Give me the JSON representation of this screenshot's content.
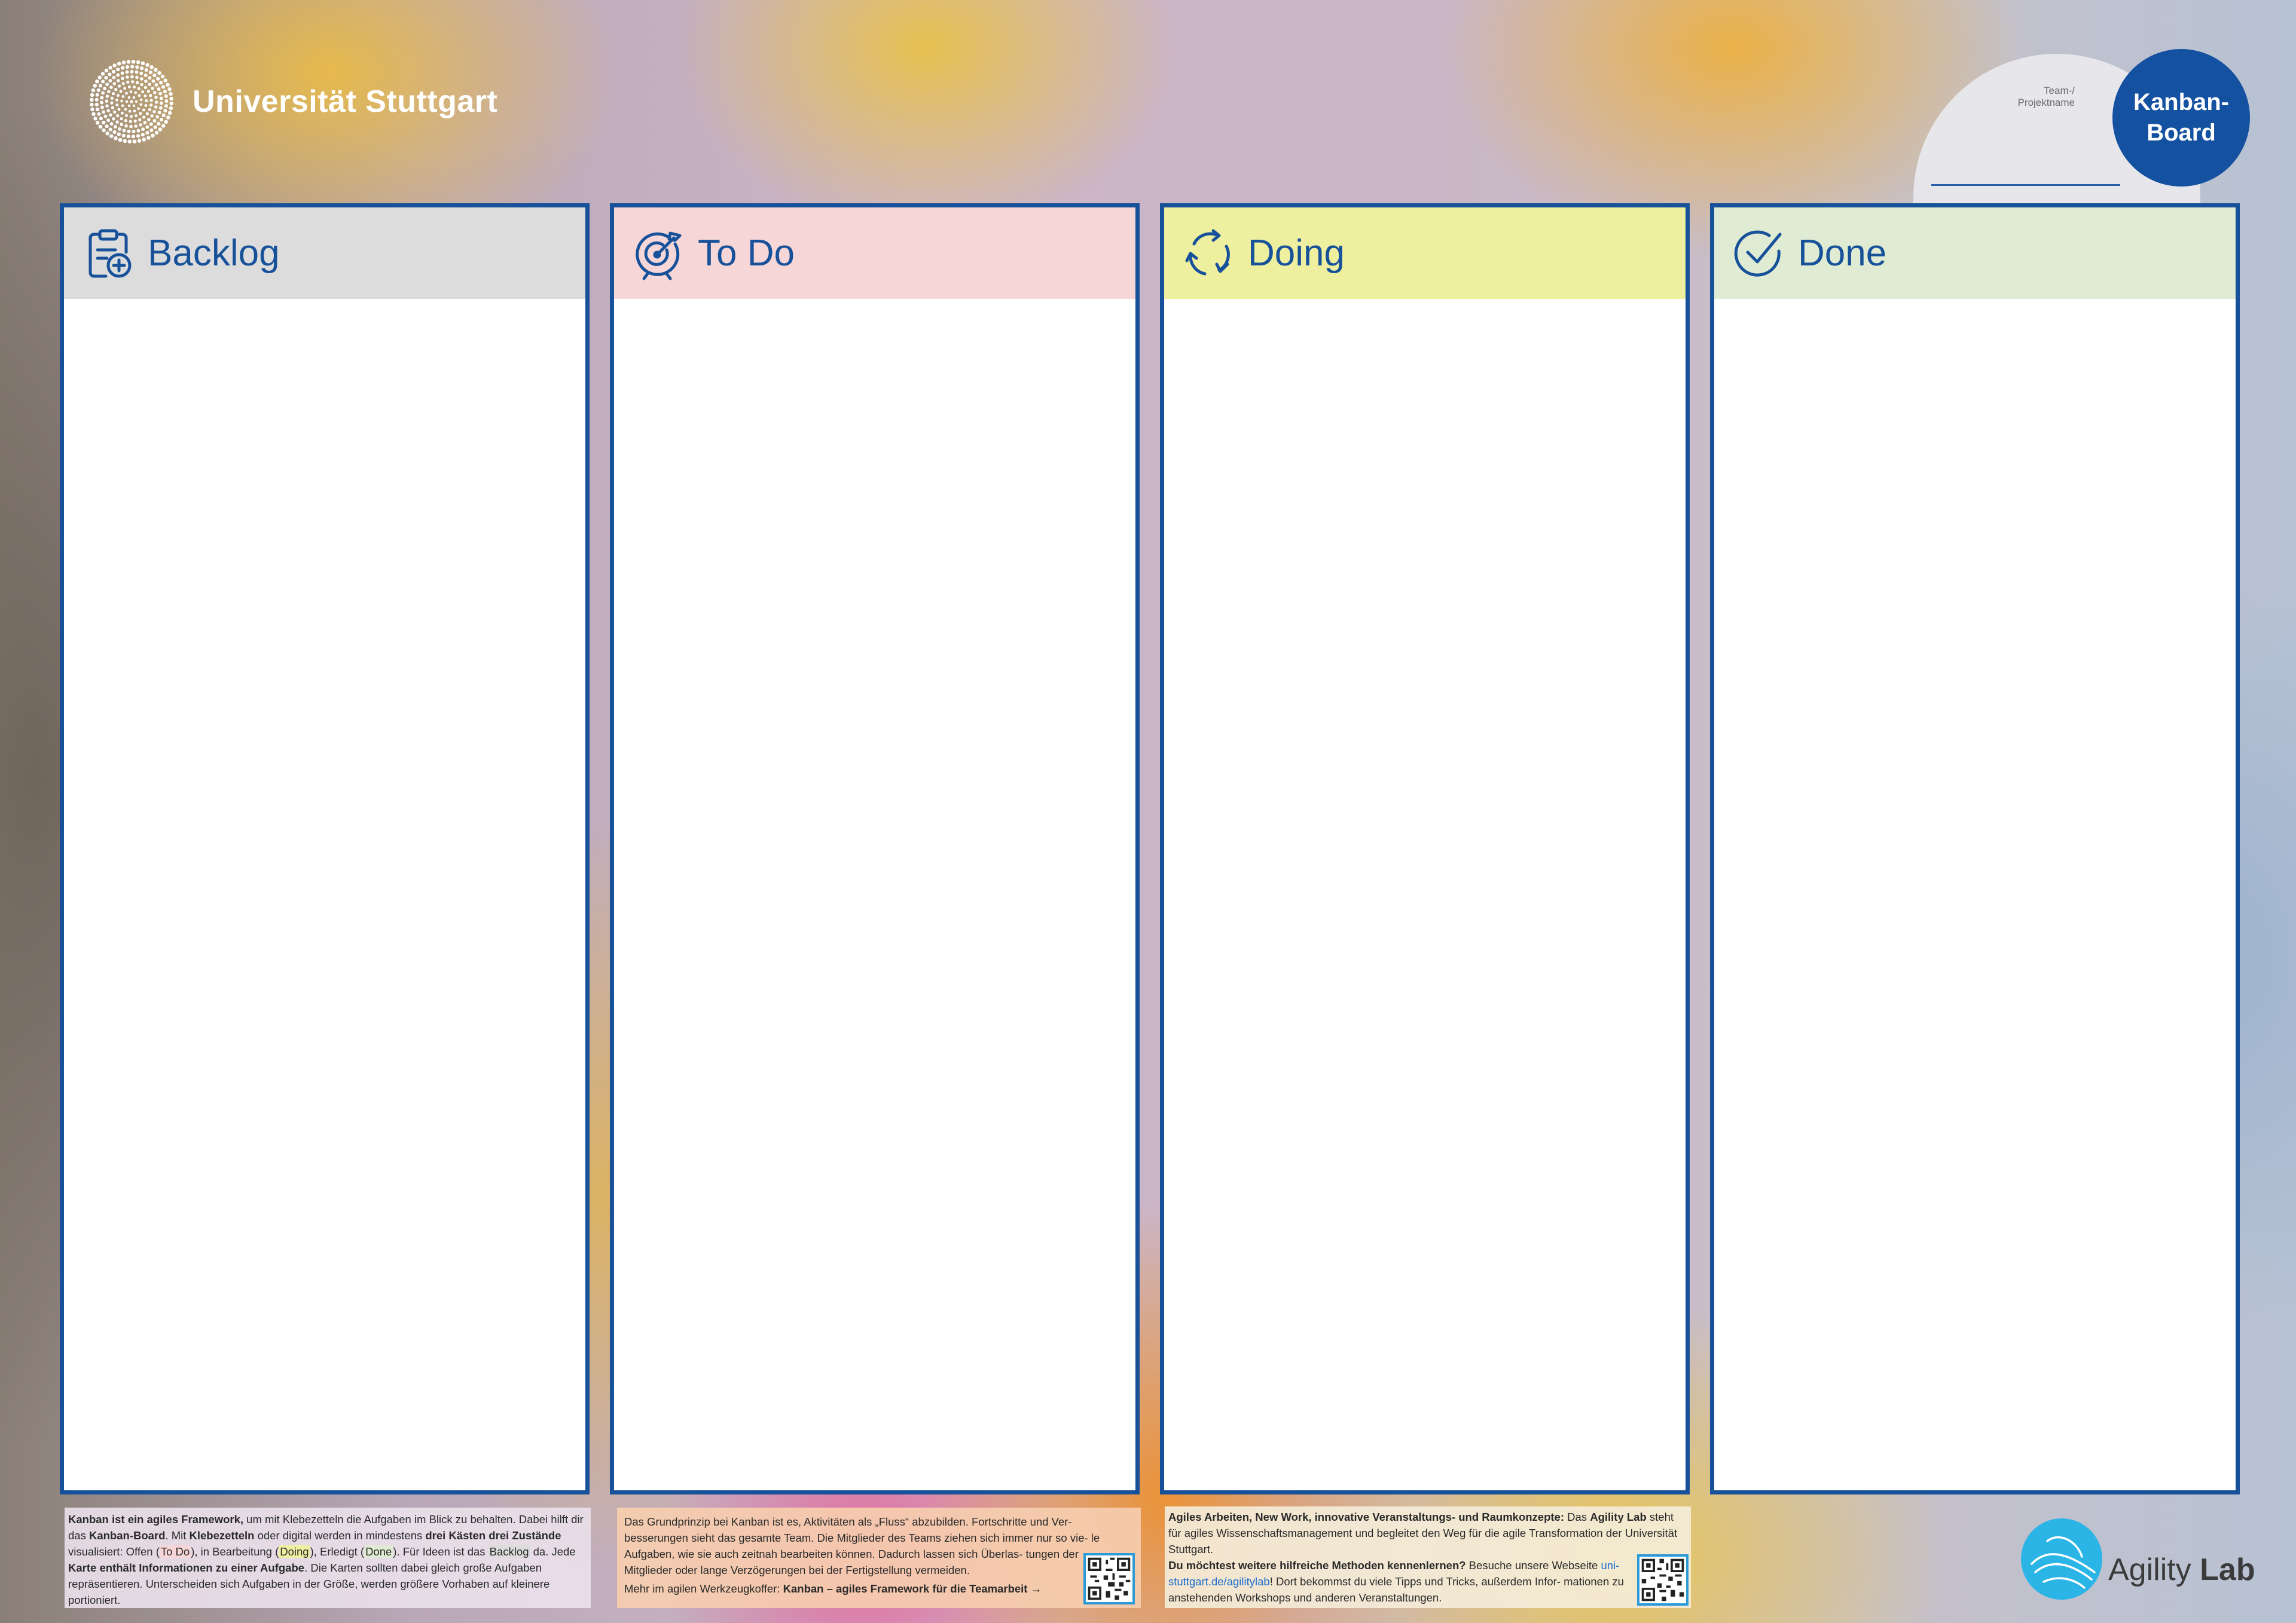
{
  "header": {
    "university_name": "Universität Stuttgart",
    "team_label_line1": "Team-/",
    "team_label_line2": "Projektname",
    "badge_line1": "Kanban-",
    "badge_line2": "Board"
  },
  "columns": [
    {
      "title": "Backlog",
      "icon": "clipboard-plus-icon",
      "header_color": "#dcdcdc"
    },
    {
      "title": "To Do",
      "icon": "target-arrow-icon",
      "header_color": "#f6d6d7"
    },
    {
      "title": "Doing",
      "icon": "refresh-cycle-icon",
      "header_color": "#eeef9f"
    },
    {
      "title": "Done",
      "icon": "check-circle-icon",
      "header_color": "#dfebd3"
    }
  ],
  "info1": {
    "s1": "Kanban ist ein agiles Framework,",
    "s2": " um mit Klebezetteln die Aufgaben im Blick zu behalten. Dabei hilft dir das ",
    "s3": "Kanban-Board",
    "s4": ". Mit ",
    "s5": "Klebezetteln",
    "s6": " oder digital werden in mindestens ",
    "s7": "drei Kästen drei Zustände",
    "s8": " visualisiert: Offen (",
    "todo": "To Do",
    "s9": "), in Bearbeitung (",
    "doing": "Doing",
    "s10": "), Erledigt (",
    "done": "Done",
    "s11": "). Für Ideen ist das ",
    "backlog": "Backlog",
    "s12": " da. Jede ",
    "s13": "Karte enthält Informationen zu einer Aufgabe",
    "s14": ". Die Karten sollten dabei gleich große Aufgaben repräsentieren. Unterscheiden sich Aufgaben in der Größe, werden größere Vorhaben auf kleinere portioniert."
  },
  "info2": {
    "text": "Das Grundprinzip bei Kanban ist es, Aktivitäten als „Fluss“ abzubilden. Fortschritte und Ver- besserungen sieht das gesamte Team. Die Mitglieder des Teams ziehen sich immer nur so vie- le Aufgaben, wie sie auch zeitnah bearbeiten können. Dadurch lassen sich Überlas- tungen der Mitglieder oder lange Verzögerungen bei der Fertigstellung vermeiden.",
    "more_prefix": "Mehr im agilen Werkzeugkoffer: ",
    "more_bold": "Kanban – agiles Framework für die Teamarbeit →"
  },
  "info3": {
    "bold1": "Agiles Arbeiten, New Work, innovative Veranstaltungs- und Raumkonzepte:",
    "text1": " Das ",
    "bold2": "Agility Lab",
    "text2": " steht für agiles Wissenschaftsmanagement und begleitet den Weg für die agile Transformation der Universität Stuttgart.",
    "bold3": "Du möchtest weitere hilfreiche Methoden kennenlernen?",
    "text3": " Besuche unsere Webseite",
    "link": "uni-stuttgart.de/agilitylab",
    "text4": "! Dort bekommst du viele Tipps und Tricks, außerdem Infor- mationen zu anstehenden Workshops und anderen Veranstaltungen."
  },
  "agility": {
    "word1": "Agility",
    "word2": "Lab"
  },
  "colors": {
    "brand_blue": "#17519a",
    "badge_blue": "#1451a0",
    "agility_cyan": "#2bb4e6"
  }
}
